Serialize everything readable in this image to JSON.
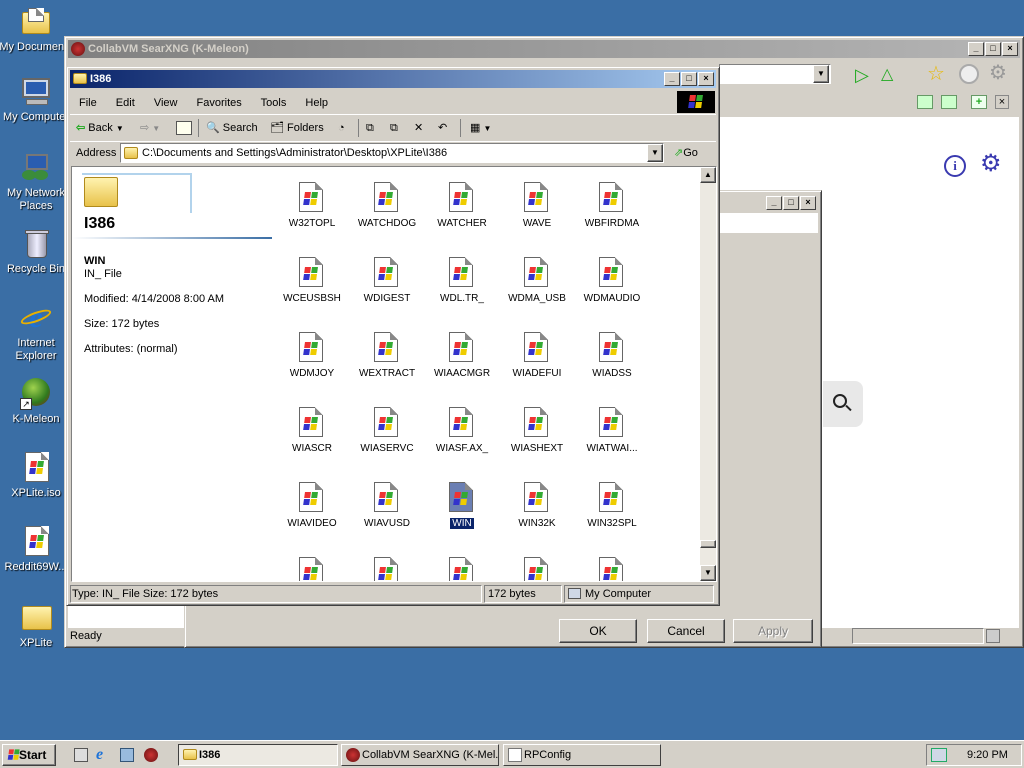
{
  "desktop": {
    "icons": [
      {
        "label": "My Documents",
        "icon": "folder-documents-icon"
      },
      {
        "label": "My Computer",
        "icon": "computer-icon"
      },
      {
        "label": "My Network Places",
        "icon": "network-icon"
      },
      {
        "label": "Recycle Bin",
        "icon": "recycle-bin-icon"
      },
      {
        "label": "Internet Explorer",
        "icon": "ie-icon"
      },
      {
        "label": "K-Meleon",
        "icon": "kmeleon-icon"
      },
      {
        "label": "XPLite.iso",
        "icon": "file-icon"
      },
      {
        "label": "Reddit69W...",
        "icon": "file-icon"
      },
      {
        "label": "XPLite",
        "icon": "folder-icon"
      }
    ]
  },
  "browser": {
    "title": "CollabVM SearXNG (K-Meleon)",
    "status": "Ready"
  },
  "dialog": {
    "ok": "OK",
    "cancel": "Cancel",
    "apply": "Apply"
  },
  "explorer": {
    "title": "I386",
    "menu": [
      "File",
      "Edit",
      "View",
      "Favorites",
      "Tools",
      "Help"
    ],
    "toolbar": {
      "back": "Back",
      "search": "Search",
      "folders": "Folders"
    },
    "address_label": "Address",
    "address": "C:\\Documents and Settings\\Administrator\\Desktop\\XPLite\\I386",
    "go": "Go",
    "panel": {
      "folder_name": "I386",
      "file_name": "WIN",
      "file_type": "IN_ File",
      "modified": "Modified: 4/14/2008 8:00 AM",
      "size": "Size: 172 bytes",
      "attributes": "Attributes: (normal)"
    },
    "files": [
      "W32TOPL",
      "WATCHDOG",
      "WATCHER",
      "WAVE",
      "WBFIRDMA",
      "WCEUSBSH",
      "WDIGEST",
      "WDL.TR_",
      "WDMA_USB",
      "WDMAUDIO",
      "WDMJOY",
      "WEXTRACT",
      "WIAACMGR",
      "WIADEFUI",
      "WIADSS",
      "WIASCR",
      "WIASERVC",
      "WIASF.AX_",
      "WIASHEXT",
      "WIATWAI...",
      "WIAVIDEO",
      "WIAVUSD",
      "WIN",
      "WIN32K",
      "WIN32SPL"
    ],
    "selected_file": "WIN",
    "status": {
      "type": "Type: IN_ File Size: 172 bytes",
      "size": "172 bytes",
      "zone": "My Computer"
    }
  },
  "taskbar": {
    "start": "Start",
    "tasks": [
      "I386",
      "CollabVM SearXNG (K-Mel...",
      "RPConfig"
    ],
    "clock": "9:20 PM"
  }
}
